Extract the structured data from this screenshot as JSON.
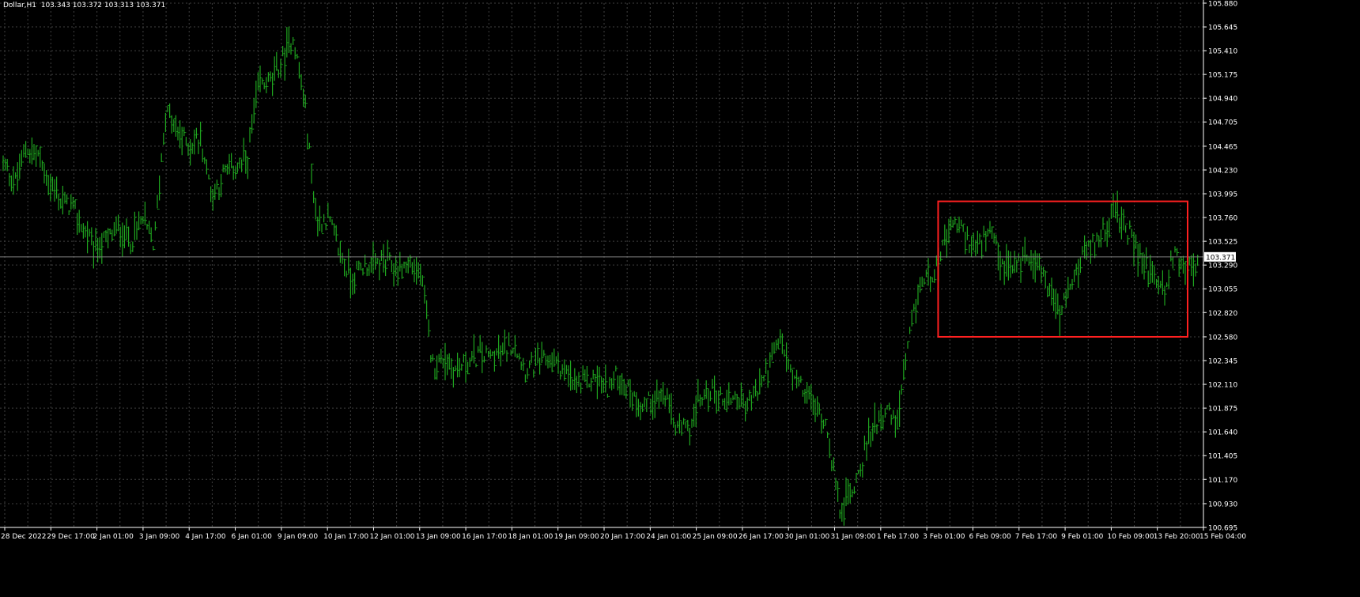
{
  "window": {
    "symbol_info": "Dollar,H1  103.343 103.372 103.313 103.371"
  },
  "colors": {
    "background": "#000000",
    "grid": "#404040",
    "bars": "#1fa51f",
    "text": "#ffffff",
    "price_line": "#808080",
    "highlight_box": "#ff2020"
  },
  "chart_data": {
    "type": "line",
    "title": "",
    "xlabel": "",
    "ylabel": "",
    "grid": true,
    "y_axis_position": "right",
    "ylim": [
      100.695,
      105.88
    ],
    "y_ticks": [
      "105.880",
      "105.645",
      "105.410",
      "105.175",
      "104.940",
      "104.705",
      "104.465",
      "104.230",
      "103.995",
      "103.760",
      "103.525",
      "103.290",
      "103.055",
      "102.820",
      "102.580",
      "102.345",
      "102.110",
      "101.875",
      "101.640",
      "101.405",
      "101.170",
      "100.930",
      "100.695"
    ],
    "x_ticks": [
      "28 Dec 2022",
      "29 Dec 17:00",
      "2 Jan 01:00",
      "3 Jan 09:00",
      "4 Jan 17:00",
      "6 Jan 01:00",
      "9 Jan 09:00",
      "10 Jan 17:00",
      "12 Jan 01:00",
      "13 Jan 09:00",
      "16 Jan 17:00",
      "18 Jan 01:00",
      "19 Jan 09:00",
      "20 Jan 17:00",
      "24 Jan 01:00",
      "25 Jan 09:00",
      "26 Jan 17:00",
      "30 Jan 01:00",
      "31 Jan 09:00",
      "1 Feb 17:00",
      "3 Feb 01:00",
      "6 Feb 09:00",
      "7 Feb 17:00",
      "9 Feb 01:00",
      "10 Feb 09:00",
      "13 Feb 20:00",
      "15 Feb 04:00"
    ],
    "current_price": 103.371,
    "current_price_label": "103.371",
    "series": [
      {
        "values": [
          104.28,
          104.1,
          104.45,
          104.38,
          104.1,
          103.92,
          103.86,
          103.62,
          103.46,
          103.55,
          103.66,
          103.52,
          103.75,
          103.48,
          104.82,
          104.6,
          104.48,
          104.55,
          103.98,
          104.18,
          104.25,
          104.32,
          105.05,
          105.1,
          105.3,
          105.55,
          104.85,
          103.72,
          103.75,
          103.42,
          103.15,
          103.28,
          103.3,
          103.32,
          103.25,
          103.3,
          103.2,
          102.3,
          102.38,
          102.25,
          102.32,
          102.4,
          102.38,
          102.42,
          102.52,
          102.25,
          102.3,
          102.35,
          102.28,
          102.12,
          102.1,
          102.18,
          102.08,
          102.2,
          102.02,
          101.9,
          101.96,
          102.0,
          101.68,
          101.66,
          101.95,
          102.05,
          101.96,
          102.0,
          101.9,
          102.05,
          102.3,
          102.55,
          102.18,
          102.05,
          101.88,
          101.7,
          100.88,
          101.02,
          101.35,
          101.72,
          101.85,
          101.7,
          102.5,
          103.1,
          103.2,
          103.45,
          103.72,
          103.55,
          103.45,
          103.6,
          103.3,
          103.25,
          103.4,
          103.35,
          103.1,
          102.78,
          103.1,
          103.35,
          103.5,
          103.7,
          103.78,
          103.6,
          103.35,
          103.2,
          103.05,
          103.42,
          103.28,
          103.26
        ]
      }
    ],
    "annotations": [
      {
        "type": "rectangle",
        "color": "red",
        "x_from": "6 Feb 09:00",
        "x_to": "15 Feb 04:00",
        "y_from": 102.58,
        "y_to": 103.92
      }
    ]
  }
}
